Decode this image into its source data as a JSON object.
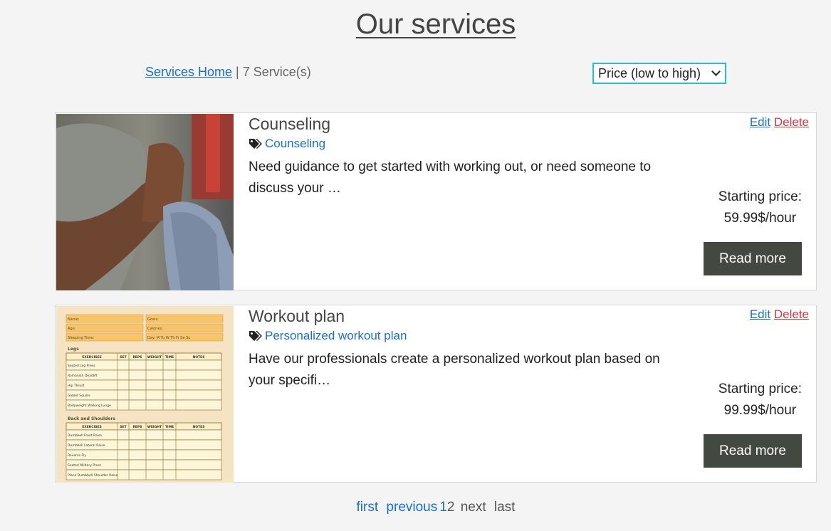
{
  "page": {
    "title": "Our services"
  },
  "toolbar": {
    "home_link": "Services Home",
    "separator": " | ",
    "count_text": "7 Service(s)",
    "sort_value": "Price (low to high)"
  },
  "services": [
    {
      "title": "Counseling",
      "tag": "Counseling",
      "description": "Need guidance to get started with working out, or need someone to discuss your …",
      "edit_label": "Edit",
      "delete_label": "Delete",
      "price_label": "Starting price:",
      "price_value": "59.99$/hour",
      "button_label": "Read more"
    },
    {
      "title": "Workout plan",
      "tag": "Personalized workout plan",
      "description": "Have our professionals create a personalized workout plan based on your specifi…",
      "edit_label": "Edit",
      "delete_label": "Delete",
      "price_label": "Starting price:",
      "price_value": "99.99$/hour",
      "button_label": "Read more"
    }
  ],
  "workout_sheet": {
    "header_fields": [
      "Name:",
      "Goals:",
      "Age:",
      "Calories:",
      "Sleeping Time:",
      "Day:  M   Tu   W   Th   Fr   Sa   Su"
    ],
    "section1": "Legs",
    "section2": "Back and Shoulders",
    "columns": [
      "EXERCISES",
      "SET",
      "REPS",
      "WEIGHT",
      "TIME",
      "NOTES"
    ],
    "legs": [
      "Seated Leg Press",
      "Romanian Deadlift",
      "Hip Thrust",
      "Goblet Squats",
      "Bodyweight Walking Lunge"
    ],
    "back": [
      "Dumbbell Front Raise",
      "Dumbbell Lateral Raise",
      "Reverse Fly",
      "Seated Military Press",
      "Plank Dumbbell Shoulder Raise"
    ]
  },
  "pagination": {
    "first": "first",
    "previous": "previous",
    "page1": "1",
    "page2": "2",
    "next": "next",
    "last": "last"
  }
}
